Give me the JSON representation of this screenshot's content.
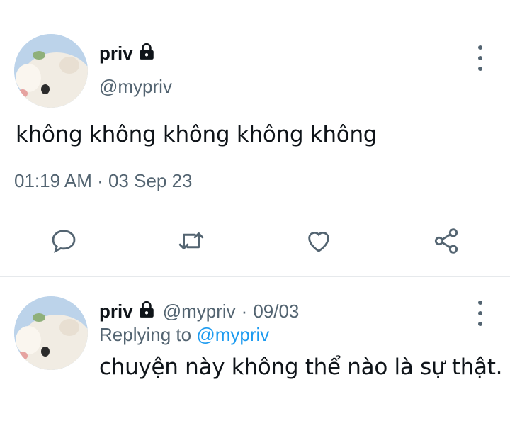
{
  "main_tweet": {
    "name": "priv",
    "handle": "@mypriv",
    "text": "không không không không không",
    "timestamp": "01:19 AM · 03 Sep 23",
    "icons": [
      "lock-icon",
      "more-icon",
      "reply-icon",
      "retweet-icon",
      "like-icon",
      "share-icon"
    ]
  },
  "reply_tweet": {
    "name": "priv",
    "handle": "@mypriv",
    "date": "09/03",
    "separator": "·",
    "replying_prefix": "Replying to",
    "replying_to": "@mypriv",
    "text": "chuyện này không thể nào là sự thật."
  },
  "colors": {
    "text": "#0f1419",
    "secondary": "#536471",
    "link": "#1d9bf0",
    "divider": "#e6e9ec"
  }
}
